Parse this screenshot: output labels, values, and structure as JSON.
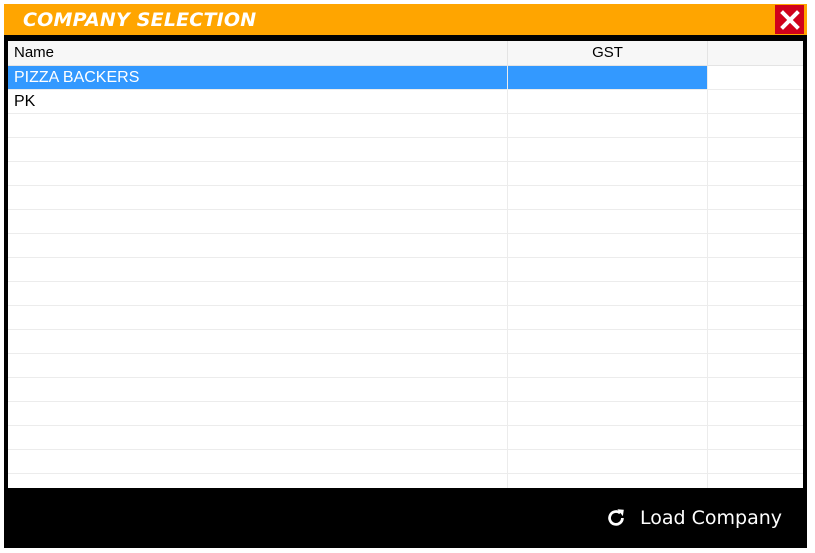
{
  "window": {
    "title": "COMPANY SELECTION",
    "close_icon": "close-icon",
    "colors": {
      "titlebar": "#ffa500",
      "close_button": "#d0021b",
      "selection": "#3399ff",
      "frame": "#000000"
    }
  },
  "table": {
    "columns": [
      "Name",
      "GST",
      ""
    ],
    "rows": [
      {
        "name": "PIZZA BACKERS",
        "gst": "",
        "selected": true
      },
      {
        "name": "PK",
        "gst": "",
        "selected": false
      }
    ],
    "empty_row_count": 16
  },
  "footer": {
    "load_label": "Load Company",
    "load_icon": "refresh-icon"
  }
}
